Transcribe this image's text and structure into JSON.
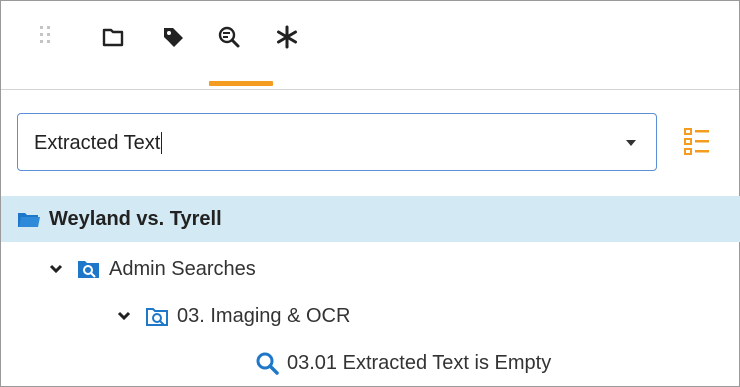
{
  "toolbar": {
    "icons": [
      "drag-handle-icon",
      "folder-icon",
      "tag-icon",
      "saved-search-icon",
      "asterisk-icon"
    ],
    "active_tab": "saved-search-icon",
    "accent_color": "#f39c1f"
  },
  "search": {
    "selected_value": "Extracted Text"
  },
  "tree": {
    "root": {
      "label": "Weyland vs. Tyrell"
    },
    "admin_searches": {
      "label": "Admin Searches"
    },
    "imaging_ocr": {
      "label": "03. Imaging & OCR"
    },
    "extracted_text_empty": {
      "label": "03.01 Extracted Text is Empty"
    }
  },
  "colors": {
    "selected_row": "#d3e9f4",
    "icon_blue": "#1f77c9",
    "input_border": "#5b8fd6"
  }
}
